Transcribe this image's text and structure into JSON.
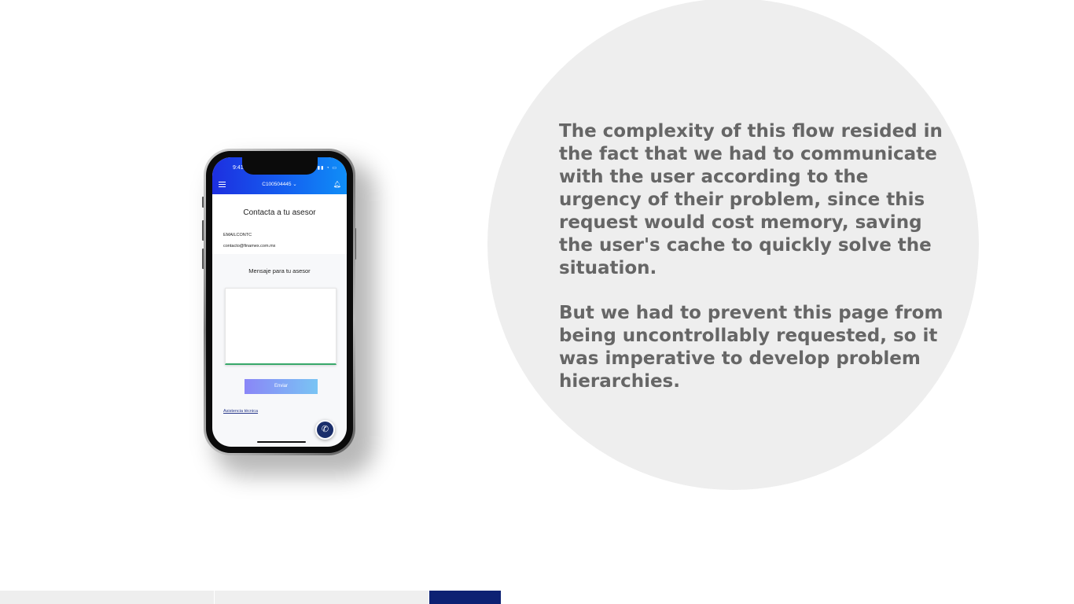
{
  "phone": {
    "status_time": "9:41",
    "account_number": "C100504445 ⌄",
    "screen_title": "Contacta a tu asesor",
    "email_label": "EMAILCONTC",
    "email_value": "contacto@finamex.com.mx",
    "message_label": "Mensaje para tu asesor",
    "message_value": "",
    "send_label": "Enviar",
    "help_link": "Asistencia técnica"
  },
  "description": {
    "paragraph1": "The complexity of this flow resided in the fact that we had to communicate with the user according to the urgency of their problem, since this request would cost memory, saving the user's cache to quickly solve the situation.",
    "paragraph2": "But we had to prevent this page from being uncontrollably requested, so it was imperative to develop problem hierarchies."
  },
  "colors": {
    "header_gradient_start": "#1d2fe0",
    "header_gradient_end": "#0f8ef7",
    "text_gray": "#666666",
    "circle_bg": "#eeeeee",
    "accent_navy": "#0d2173"
  },
  "icons": [
    "menu-icon",
    "bell-icon",
    "whatsapp-icon"
  ]
}
